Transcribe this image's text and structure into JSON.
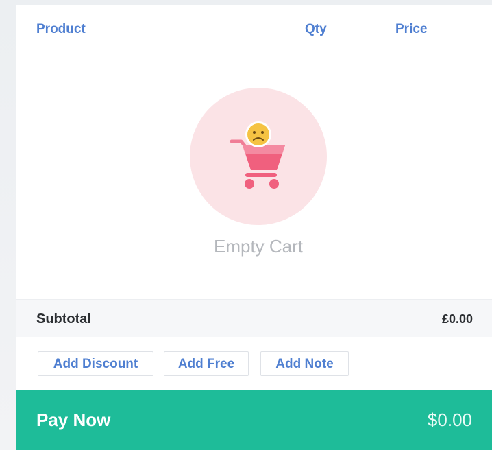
{
  "header": {
    "product": "Product",
    "qty": "Qty",
    "price": "Price"
  },
  "empty_state": {
    "text": "Empty Cart",
    "icon": "sad-shopping-cart-icon"
  },
  "summary": {
    "subtotal_label": "Subtotal",
    "subtotal_value": "£0.00"
  },
  "actions": {
    "add_discount": "Add Discount",
    "add_free": "Add Free",
    "add_note": "Add Note"
  },
  "pay": {
    "label": "Pay Now",
    "total": "$0.00"
  },
  "colors": {
    "accent_blue": "#4f7fd1",
    "pay_green": "#1ebc99",
    "empty_circle": "#fbe3e6",
    "cart_pink": "#f0607e",
    "face_yellow": "#f5c343"
  }
}
